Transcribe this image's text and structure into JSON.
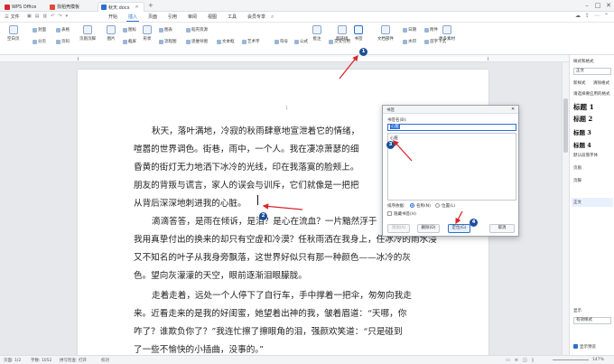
{
  "titlebar": {
    "tabs": [
      "WPS Office",
      "找稻壳模板",
      "秋天.docx"
    ]
  },
  "menu": {
    "file": "三 文件",
    "items": [
      "开始",
      "插入",
      "页面",
      "引用",
      "审阅",
      "视图",
      "工具",
      "会员专享"
    ],
    "active_index": 1
  },
  "ribbon": {
    "large": [
      "空白页",
      "页眉页脚",
      "图片",
      "形状",
      "批注",
      "超链接",
      "书签",
      "文档部件",
      "更多素材"
    ],
    "small_rows": [
      [
        "封面",
        "表格",
        "图标",
        "图表",
        "稻壳资源"
      ],
      [
        "分页",
        "页码",
        "截屏",
        "流程图",
        "思维导图",
        "文本框",
        "艺术字",
        "符号",
        "公式",
        "交叉引用",
        "日期",
        "水印",
        "首字下沉",
        "附件"
      ]
    ]
  },
  "document": {
    "paragraphs": [
      [
        "秋天，落叶满地，冷寂的秋雨肆意地宣泄着它的情绪，",
        "喧嚣的世界调色。街巷，雨中，一个人。我在凄凉萧瑟的细",
        "昏黄的街灯无力地洒下冰冷的光线，印在我落寞的脸颊上。",
        "朋友的背叛与谎言，家人的误会与训斥，它们就像是一把把",
        "从背后深深地刺进我的心脏。"
      ],
      [
        "滴滴答答，是雨在倾诉，是泪？是心在流血？一片黯然浮于",
        "我用真挚付出的换来的却只有空虚和冷漠？任秋雨洒在我身上，任冰冷的雨水浸",
        "又不知名的叶子从我身旁飘落，这世界好似只有那一种颜色——冰冷的灰",
        "色。望向灰濛濛的天空，眼前逐渐泪眼朦胧。"
      ],
      [
        "走着走着，远处一个人停下了自行车，手中撑着一把伞，匆匆向我走",
        "来。近看走来的是我的好闺蜜，她望着出神的我，皱着眉道：“天哪，你",
        "咋了？谁欺负你了？”我连忙擦了擦眼角的泪，强颜欢笑道：“只是碰到",
        "了一些不愉快的小插曲，没事的。”"
      ]
    ]
  },
  "right_panel": {
    "title": "样式和格式",
    "current_style": "正文",
    "new_style": "新样式",
    "clear_format": "清除格式",
    "pick_label": "请选择要应用的格式",
    "headings": [
      "标题 1",
      "标题 2",
      "标题 3",
      "标题 4"
    ],
    "others": [
      "默认段落字体",
      "页眉",
      "页脚",
      "正文"
    ],
    "show_label": "显示",
    "show_value": "有效样式",
    "preview_label": "显示预览"
  },
  "dialog": {
    "title": "书签",
    "name_label": "书签名(B):",
    "name_value": "心脏",
    "list_item": "心脏",
    "sort_label": "排序依据:",
    "sort_options": [
      "名称(N)",
      "位置(L)"
    ],
    "hidden_label": "隐藏书签(H)",
    "buttons": {
      "delete": "删除(D)",
      "goto": "定位(G)",
      "add": "添加(A)",
      "cancel": "取消"
    }
  },
  "markers": [
    "1",
    "2",
    "3",
    "4"
  ],
  "statusbar": {
    "page": "页面: 1/2",
    "words": "字数: 1052",
    "spell": "拼写检查: 打开",
    "proof": "校对",
    "zoom": "147%"
  },
  "colors": {
    "accent": "#2b6fd6",
    "arrow": "#d9262c",
    "marker": "#1d4f9a"
  }
}
